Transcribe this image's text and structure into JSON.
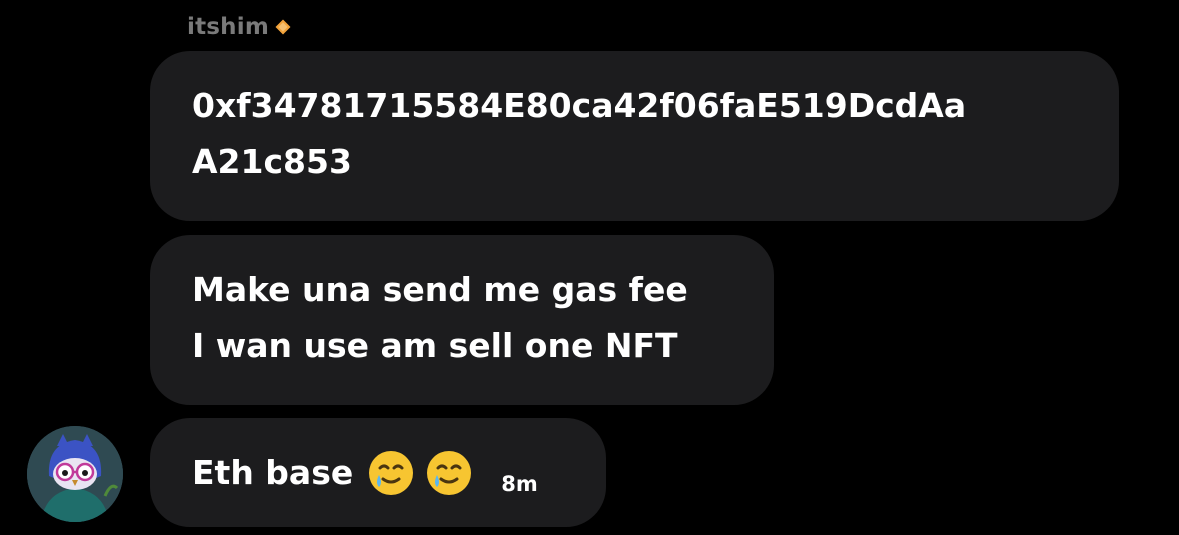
{
  "sender": {
    "name": "itshim",
    "badge_icon": "orange-diamond-icon",
    "badge_color": "#f2a23a"
  },
  "messages": [
    {
      "lines": [
        "0xf34781715584E80ca42f06faE519DcdAa",
        "A21c853"
      ]
    },
    {
      "lines": [
        "Make una send me gas fee",
        "I wan use am sell one NFT"
      ]
    },
    {
      "text": "Eth base",
      "emojis": [
        "smiling-face-with-tear-icon",
        "smiling-face-with-tear-icon"
      ],
      "timestamp": "8m"
    }
  ],
  "avatar": {
    "icon": "owl-avatar-icon"
  },
  "colors": {
    "background": "#000000",
    "bubble": "#1c1c1e",
    "sender_name": "#7a7a7a",
    "text": "#ffffff"
  }
}
